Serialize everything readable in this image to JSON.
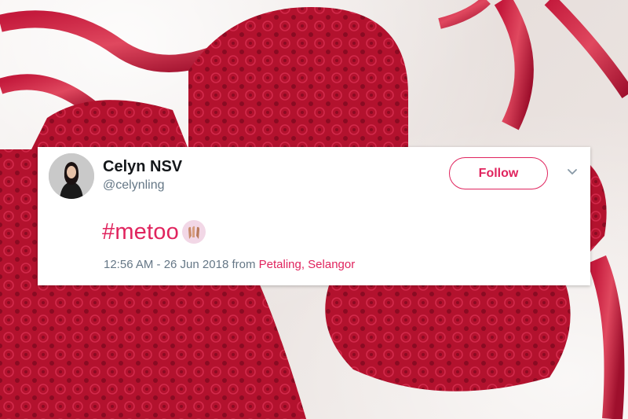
{
  "tweet": {
    "display_name": "Celyn NSV",
    "handle": "@celynling",
    "follow_label": "Follow",
    "hashtag": "#metoo",
    "emoji": "raised-hands-emoji",
    "timestamp": "12:56 AM - 26 Jun 2018",
    "from_label": "from",
    "location": "Petaling, Selangor"
  },
  "colors": {
    "accent": "#e0245e",
    "text_primary": "#14171a",
    "text_secondary": "#657786",
    "lingerie_red": "#b3122e"
  },
  "icons": {
    "avatar": "avatar",
    "menu": "chevron-down-icon"
  }
}
